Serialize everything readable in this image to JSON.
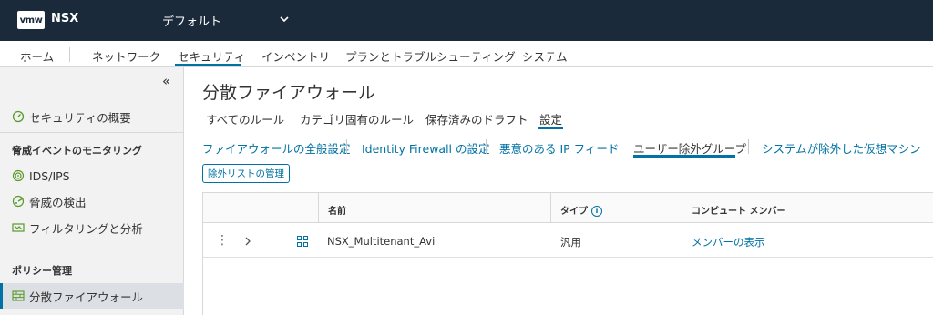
{
  "header": {
    "logo_text": "vmw",
    "app_name": "NSX",
    "project": "デフォルト"
  },
  "nav": {
    "items": [
      "ホーム",
      "ネットワーク",
      "セキュリティ",
      "インベントリ",
      "プランとトラブルシューティング",
      "システム"
    ],
    "active": "セキュリティ"
  },
  "sidebar": {
    "overview": "セキュリティの概要",
    "section_monitoring": "脅威イベントのモニタリング",
    "ids_ips": "IDS/IPS",
    "threat_detection": "脅威の検出",
    "filtering": "フィルタリングと分析",
    "section_policy": "ポリシー管理",
    "dfw": "分散ファイアウォール"
  },
  "main": {
    "title": "分散ファイアウォール",
    "tabs": [
      "すべてのルール",
      "カテゴリ固有のルール",
      "保存済みのドラフト",
      "設定"
    ],
    "active_tab": "設定",
    "subtabs": [
      "ファイアウォールの全般設定",
      "Identity Firewall の設定",
      "悪意のある IP フィード",
      "ユーザー除外グループ",
      "システムが除外した仮想マシン"
    ],
    "active_subtab": "ユーザー除外グループ",
    "manage_button": "除外リストの管理"
  },
  "table": {
    "columns": [
      "名前",
      "タイプ",
      "コンピュート メンバー"
    ],
    "rows": [
      {
        "name": "NSX_Multitenant_Avi",
        "type": "汎用",
        "members": "メンバーの表示"
      }
    ]
  },
  "colors": {
    "header_bg": "#1b2a3a",
    "accent": "#0072a3",
    "sidebar_bg": "#f2f2f2"
  }
}
